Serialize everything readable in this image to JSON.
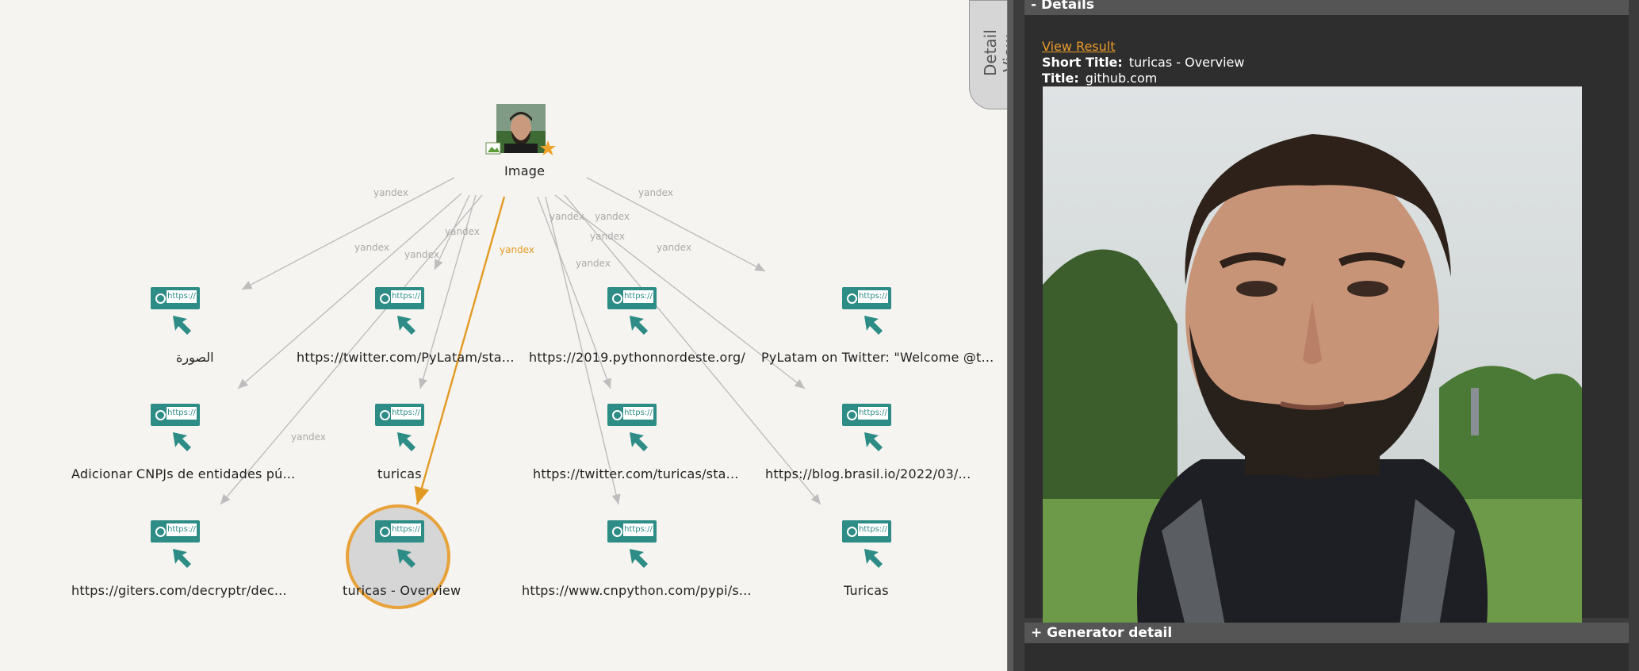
{
  "graph": {
    "root": {
      "label": "Image",
      "icon": "face-photo-icon"
    },
    "edge_label": "yandex",
    "url_badge_text": "https://",
    "nodes": [
      {
        "label": "الصورة",
        "icon": "url-node-icon"
      },
      {
        "label": "https://twitter.com/PyLatam/sta...",
        "icon": "url-node-icon"
      },
      {
        "label": "https://2019.pythonnordeste.org/",
        "icon": "url-node-icon"
      },
      {
        "label": "PyLatam on Twitter: \"Welcome @t...",
        "icon": "url-node-icon"
      },
      {
        "label": "Adicionar CNPJs de entidades pú...",
        "icon": "url-node-icon"
      },
      {
        "label": "turicas",
        "icon": "url-node-icon"
      },
      {
        "label": "https://twitter.com/turicas/sta...",
        "icon": "url-node-icon"
      },
      {
        "label": "https://blog.brasil.io/2022/03/...",
        "icon": "url-node-icon"
      },
      {
        "label": "https://giters.com/decryptr/dec...",
        "icon": "url-node-icon"
      },
      {
        "label": "turicas - Overview",
        "icon": "url-node-icon",
        "selected": true
      },
      {
        "label": "https://www.cnpython.com/pypi/s...",
        "icon": "url-node-icon"
      },
      {
        "label": "Turicas",
        "icon": "url-node-icon"
      }
    ]
  },
  "side_tab": {
    "label": "Detail View"
  },
  "details": {
    "header": "- Details",
    "view_result": "View Result",
    "short_title_label": "Short Title:",
    "short_title_value": "turicas - Overview",
    "title_label": "Title:",
    "title_value": "github.com"
  },
  "generator": {
    "header": "+ Generator detail"
  },
  "colors": {
    "accent": "#e39a24",
    "node_teal": "#2d8c86",
    "edge_grey": "#bdbdbd",
    "panel_bg": "#3c3c3c"
  }
}
